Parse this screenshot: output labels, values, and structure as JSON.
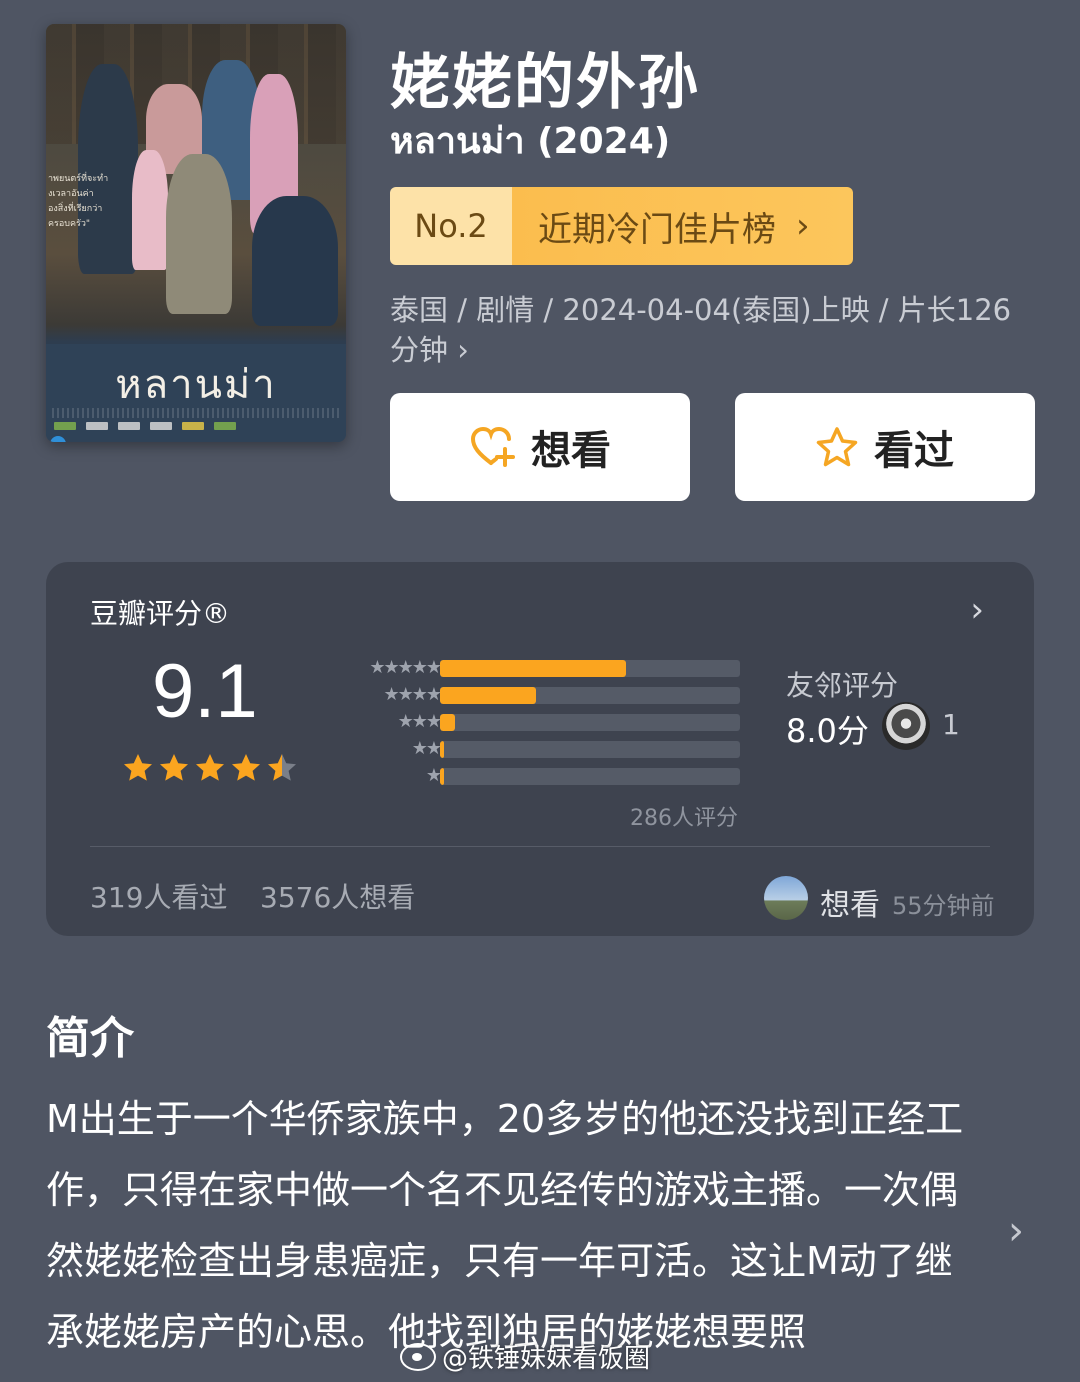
{
  "movie": {
    "title_zh": "姥姥的外孙",
    "title_original": "หลานม่า (2024)",
    "poster_title": "หลานม่า",
    "poster_side_text": "าพยนตร์ที่จะทำ\nงเวลาอันค่า\nองสิ่งที่เรียกว่า\nครอบครัว\"",
    "rank": {
      "no": "No.2",
      "name": "近期冷门佳片榜",
      "chevron": "›"
    },
    "meta": "泰国 / 剧情 / 2024-04-04(泰国)上映 / 片长126分钟 ›"
  },
  "actions": {
    "want_label": "想看",
    "want_icon": "heart-plus-icon",
    "seen_label": "看过",
    "seen_icon": "star-outline-icon",
    "icon_color": "#f5a623"
  },
  "rating": {
    "title": "豆瓣评分®",
    "arrow": "›",
    "score": "9.1",
    "stars": 4.5,
    "distribution": [
      {
        "stars": "★★★★★",
        "fraction": 0.62
      },
      {
        "stars": "★★★★",
        "fraction": 0.32
      },
      {
        "stars": "★★★",
        "fraction": 0.05
      },
      {
        "stars": "★★",
        "fraction": 0.006
      },
      {
        "stars": "★",
        "fraction": 0.006
      }
    ],
    "count_label": "286人评分",
    "friend_label": "友邻评分",
    "friend_score": "8.0分",
    "friend_count": "1",
    "seen_count": "319人看过",
    "want_count": "3576人想看",
    "activity_action": "想看",
    "activity_time": "55分钟前"
  },
  "synopsis": {
    "title": "简介",
    "text": "M出生于一个华侨家族中，20多岁的他还没找到正经工作，只得在家中做一个名不见经传的游戏主播。一次偶然姥姥检查出身患癌症，只有一年可活。这让M动了继承姥姥房产的心思。他找到独居的姥姥想要照",
    "arrow": "›"
  },
  "watermark": "@铁锤妹妹看饭圈",
  "colors": {
    "background": "#4f5563",
    "card": "#3e434f",
    "accent": "#fba51f",
    "rank_badge": "#fbbd4e"
  }
}
